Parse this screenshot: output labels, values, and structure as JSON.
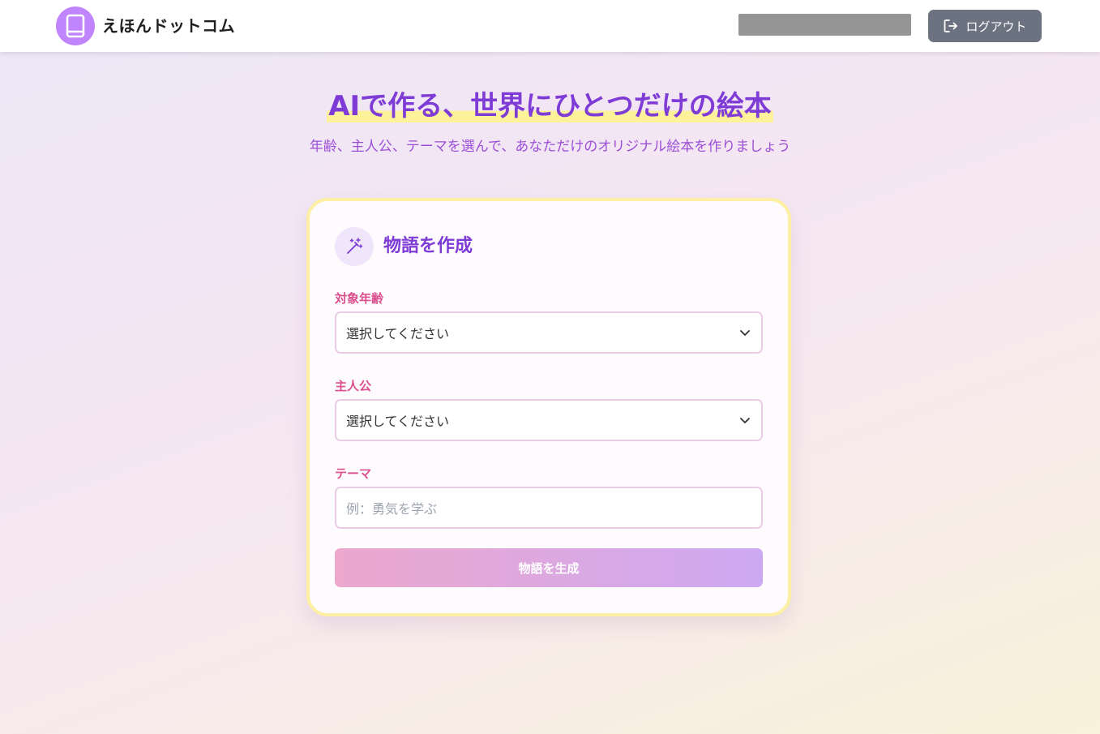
{
  "header": {
    "app_name": "えほんドットコム",
    "logout_label": "ログアウト"
  },
  "hero": {
    "title": "AIで作る、世界にひとつだけの絵本",
    "subtitle": "年齢、主人公、テーマを選んで、あなただけのオリジナル絵本を作りましょう"
  },
  "form": {
    "title": "物語を作成",
    "age": {
      "label": "対象年齢",
      "value": "選択してください"
    },
    "protagonist": {
      "label": "主人公",
      "value": "選択してください"
    },
    "theme": {
      "label": "テーマ",
      "placeholder": "例：勇気を学ぶ"
    },
    "submit_label": "物語を生成"
  },
  "colors": {
    "accent_purple": "#7e3bd6",
    "label_pink": "#db4f8e",
    "logo_purple": "#c084fc",
    "logout_gray": "#6b7280",
    "highlight_yellow": "#fdf19a"
  },
  "icons": {
    "logo": "book-icon",
    "logout": "logout-icon",
    "card": "magic-wand-icon",
    "select": "chevron-down-icon"
  }
}
